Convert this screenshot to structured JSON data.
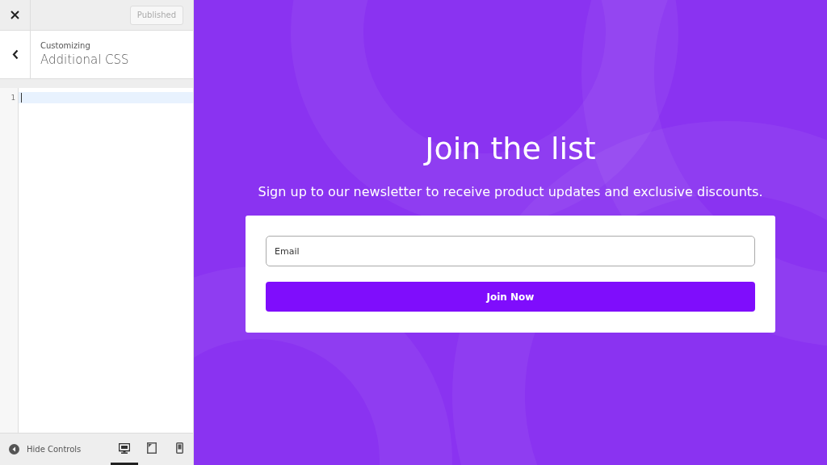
{
  "header": {
    "publish_button": "Published",
    "publish_disabled": true
  },
  "section": {
    "breadcrumb": "Customizing",
    "title": "Additional CSS"
  },
  "editor": {
    "line_numbers": [
      "1"
    ]
  },
  "footer": {
    "hide_controls": "Hide Controls",
    "devices": [
      {
        "kind": "desktop",
        "selected": true
      },
      {
        "kind": "tablet",
        "selected": false
      },
      {
        "kind": "mobile",
        "selected": false
      }
    ]
  },
  "preview": {
    "title": "Join the list",
    "subtitle": "Sign up to our newsletter to receive product updates and exclusive discounts.",
    "email_placeholder": "Email",
    "button": "Join Now"
  }
}
